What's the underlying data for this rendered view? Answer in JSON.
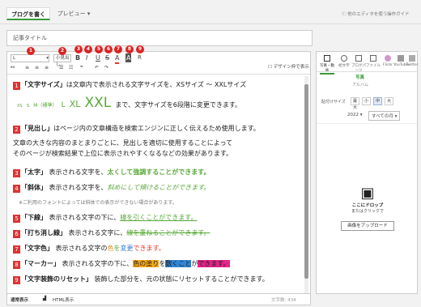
{
  "topbar": {
    "tab_write": "ブログを書く",
    "tab_preview": "プレビュー",
    "link_editor": "他のエディタを使う",
    "link_settings": "操作ガイド"
  },
  "title_field": {
    "placeholder": "記事タイトル"
  },
  "toolbar": {
    "font_size_select": "L",
    "heading_select": "小見出し",
    "bold": "B",
    "italic": "I",
    "underline": "U",
    "strike": "S",
    "color": "A",
    "marker": "A",
    "reset": "R",
    "design_checkbox_label": "デザイン枠で表示",
    "badges": [
      "1",
      "2",
      "3",
      "4",
      "5",
      "6",
      "7",
      "8",
      "9"
    ]
  },
  "content": {
    "l1_num": "1",
    "l1_a": "「文字サイズ」",
    "l1_b": "は文章内で表示される文字サイズを、XSサイズ ～ XXLサイズ",
    "l2_xs": "XS",
    "l2_s": "S",
    "l2_m": "M（標準）",
    "l2_l": "L",
    "l2_xl": "XL",
    "l2_xxl": "XXL",
    "l2_rest": "まで、文字サイズを6段階に変更できます。",
    "l3_num": "2",
    "l3_a": "「見出し」",
    "l3_b": "はページ内の文章構造を検索エンジンに正しく伝えるため使用します。",
    "l4": "文章の大きな内容のまとまりごとに、見出しを適切に使用することによって",
    "l5": "そのページが検索結果で上位に表示されやすくなるなどの効果があります。",
    "l6_num": "3",
    "l6_a": "「太字」",
    "l6_b": "表示される文字を、",
    "l6_c": "太くして強調することができます。",
    "l7_num": "4",
    "l7_a": "「斜体」",
    "l7_b": "表示される文字を、",
    "l7_c": "斜めにして傾けることができます。",
    "l8": "※ご利用のフォントによっては斜体での表示ができない場合があります。",
    "l9_num": "5",
    "l9_a": "「下線」",
    "l9_b": "表示される文字の下に、",
    "l9_c": "線を引くことができます。",
    "l10_num": "6",
    "l10_a": "「打ち消し線」",
    "l10_b": "表示される文字に、",
    "l10_c": "線を重ねることができます。",
    "l11_num": "7",
    "l11_a": "「文字色」",
    "l11_b": "表示される文字の",
    "l11_c1": "色",
    "l11_c2": "を",
    "l11_c3": "変更",
    "l11_c4": "できます。",
    "l12_num": "8",
    "l12_a": "「マーカー」",
    "l12_b": "表示される文字の下に、",
    "l12_c1": "色の塗り",
    "l12_c2": "を",
    "l12_c3": "敷くこと",
    "l12_c4": "が",
    "l12_c5": "できます。",
    "l13_num": "9",
    "l13_a": "「文字装飾のリセット」",
    "l13_b": "装飾した部分を、元の状態にリセットすることができます。"
  },
  "footer": {
    "mode_normal": "通常表示",
    "mode_html": "HTML表示",
    "char_count": "文字数: 434"
  },
  "panel": {
    "tabs": [
      "写真・動画",
      "絵文字",
      "ブログパーツ",
      "ファイル",
      "Flickr",
      "YouTube",
      "Twitter"
    ],
    "subtab": "写真",
    "subtab2": "アルバム",
    "size_label": "貼付けサイズ",
    "sizes": [
      "最大",
      "小",
      "中",
      "大"
    ],
    "year": "2022",
    "month": "すべての月",
    "drop_text_1": "ここにドロップ",
    "drop_text_2": "またはクリックで",
    "upload_button": "画像をアップロード"
  },
  "colors": {
    "accent": "#3a9b3a",
    "num_badge": "#d33333",
    "marker_orange": "#f7a814",
    "marker_blue": "#2f86d4",
    "marker_pink": "#e6238a"
  }
}
